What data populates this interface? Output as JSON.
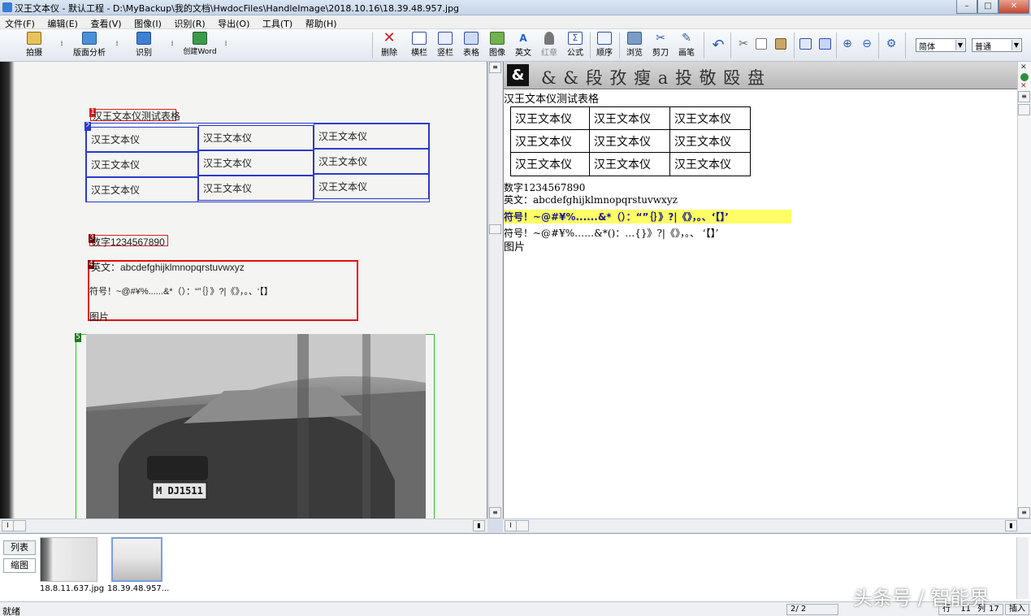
{
  "window": {
    "title": "汉王文本仪 - 默认工程 - D:\\MyBackup\\我的文档\\HwdocFiles\\HandleImage\\2018.10.16\\18.39.48.957.jpg",
    "buttons": {
      "minimize": "–",
      "maximize": "□",
      "close": "✕"
    }
  },
  "menu": [
    "文件(F)",
    "编辑(E)",
    "查看(V)",
    "图像(I)",
    "识别(R)",
    "导出(O)",
    "工具(T)",
    "帮助(H)"
  ],
  "toolbar": {
    "left_tools": [
      {
        "label": "拍摄",
        "icon": "camera-icon"
      },
      {
        "label": "版面分析",
        "icon": "layout-analysis-icon"
      },
      {
        "label": "识别",
        "icon": "recognize-icon"
      },
      {
        "label": "创建Word",
        "icon": "word-icon"
      }
    ],
    "right_tools": [
      {
        "label": "删除",
        "icon": "delete-icon"
      },
      {
        "label": "横栏",
        "icon": "horizontal-column-icon"
      },
      {
        "label": "竖栏",
        "icon": "vertical-column-icon"
      },
      {
        "label": "表格",
        "icon": "table-icon"
      },
      {
        "label": "图像",
        "icon": "image-icon"
      },
      {
        "label": "英文",
        "icon": "english-icon"
      },
      {
        "label": "红章",
        "icon": "red-stamp-icon"
      },
      {
        "label": "公式",
        "icon": "formula-icon"
      },
      {
        "label": "顺序",
        "icon": "order-icon"
      },
      {
        "label": "浏览",
        "icon": "browse-icon"
      },
      {
        "label": "剪刀",
        "icon": "scissors-icon"
      },
      {
        "label": "画笔",
        "icon": "brush-icon"
      }
    ],
    "font_family_value": "简体",
    "font_style_value": "普通"
  },
  "left_image": {
    "title_line": "汉王文本仪测试表格",
    "table_rows": [
      [
        "汉王文本仪",
        "汉王文本仪",
        "汉王文本仪"
      ],
      [
        "汉王文本仪",
        "汉王文本仪",
        "汉王文本仪"
      ],
      [
        "汉王文本仪",
        "汉王文本仪",
        "汉王文本仪"
      ]
    ],
    "digits_line": "数字1234567890",
    "english_line": "英文：abcdefghijklmnopqrstuvwxyz",
    "symbol_line": "符号！~@#¥%......&*（）：“”｛｝》?|《》，。、‘【】",
    "picture_line": "图片",
    "plate_text": "M DJ1511",
    "zone_tags": [
      "1",
      "2",
      "3",
      "4",
      "5"
    ]
  },
  "right_text": {
    "header_glyphs": "& & 段 孜  瘦  a 投 敬  殴 盘",
    "title_line": "汉王文本仪测试表格",
    "table_rows": [
      [
        "汉王文本仪",
        "汉王文本仪",
        "汉王文本仪"
      ],
      [
        "汉王文本仪",
        "汉王文本仪",
        "汉王文本仪"
      ],
      [
        "汉王文本仪",
        "汉王文本仪",
        "汉王文本仪"
      ]
    ],
    "digits_line": "数字1234567890",
    "english_line": "英文：abcdefghijklmnopqrstuvwxyz",
    "symbol_highlight_line": "符号！~@#¥%......&*（）：“”｛｝》?|《》，。、‘【】’",
    "symbol_line": "符号！~@#¥%……&*()：…{}》?|《》，。、 ‘【】’",
    "picture_line": "图片"
  },
  "thumbnails": {
    "tabs": [
      "列表",
      "缩图"
    ],
    "items": [
      {
        "caption": "18.8.11.637.jpg"
      },
      {
        "caption": "18.39.48.957..."
      }
    ]
  },
  "status": {
    "left": "就绪",
    "page": "2/  2",
    "row_label": "行",
    "row_value": "11",
    "col_label": "列",
    "col_value": "17",
    "mode": "插入"
  },
  "watermark": "头条号 / 智能界",
  "colors": {
    "title_zone": "#d42020",
    "table_zone": "#2b3bc8",
    "text_zone": "#e01010",
    "image_zone": "#33bb33",
    "highlight": "#ffff66"
  }
}
